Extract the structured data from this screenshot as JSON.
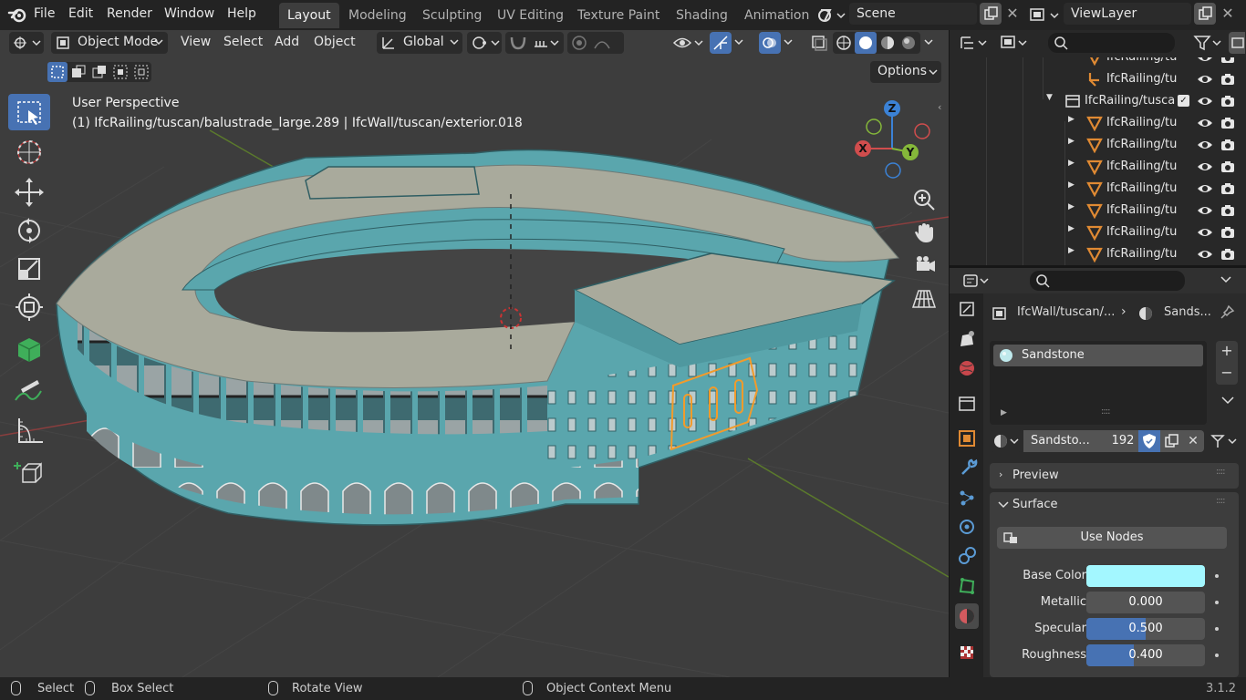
{
  "topbar": {
    "menus": [
      "File",
      "Edit",
      "Render",
      "Window",
      "Help"
    ],
    "tabs": [
      "Layout",
      "Modeling",
      "Sculpting",
      "UV Editing",
      "Texture Paint",
      "Shading",
      "Animation"
    ],
    "scene": "Scene",
    "view_layer": "ViewLayer"
  },
  "viewport": {
    "mode": "Object Mode",
    "menus": [
      "View",
      "Select",
      "Add",
      "Object"
    ],
    "transform_orientation": "Global",
    "options_label": "Options",
    "perspective_label": "User Perspective",
    "object_info": "(1) IfcRailing/tuscan/balustrade_large.289 | IfcWall/tuscan/exterior.018",
    "gizmo": {
      "z": "Z",
      "x": "X",
      "y": "Y"
    }
  },
  "outliner": {
    "rows": [
      {
        "label": "IfcRailing/tu",
        "icon": "mesh-icon"
      },
      {
        "label": "IfcRailing/tu",
        "icon": "empty-icon"
      },
      {
        "label": "IfcRailing/tusca",
        "icon": "collection-icon"
      },
      {
        "label": "IfcRailing/tu",
        "icon": "mesh-icon"
      },
      {
        "label": "IfcRailing/tu",
        "icon": "mesh-icon"
      },
      {
        "label": "IfcRailing/tu",
        "icon": "mesh-icon"
      },
      {
        "label": "IfcRailing/tu",
        "icon": "mesh-icon"
      },
      {
        "label": "IfcRailing/tu",
        "icon": "mesh-icon"
      },
      {
        "label": "IfcRailing/tu",
        "icon": "mesh-icon"
      },
      {
        "label": "IfcRailing/tu",
        "icon": "mesh-icon"
      }
    ]
  },
  "properties": {
    "breadcrumb_object": "IfcWall/tuscan/...",
    "breadcrumb_material": "Sands...",
    "slot_name": "Sandstone",
    "material_name": "Sandsto...",
    "user_count": "192",
    "preview_label": "Preview",
    "surface_label": "Surface",
    "use_nodes_label": "Use Nodes",
    "fields": {
      "base_color": {
        "label": "Base Color",
        "color": "#a3f7ff"
      },
      "metallic": {
        "label": "Metallic",
        "value": "0.000",
        "fraction": 0
      },
      "specular": {
        "label": "Specular",
        "value": "0.500",
        "fraction": 0.5
      },
      "roughness": {
        "label": "Roughness",
        "value": "0.400",
        "fraction": 0.4
      }
    }
  },
  "status": {
    "select": "Select",
    "box_select": "Box Select",
    "rotate_view": "Rotate View",
    "context_menu": "Object Context Menu",
    "version": "3.1.2"
  },
  "colors": {
    "accent": "#4772b3",
    "building": "#5aa6ad",
    "roof": "#a9aa9c",
    "selection": "#f29b2b"
  }
}
